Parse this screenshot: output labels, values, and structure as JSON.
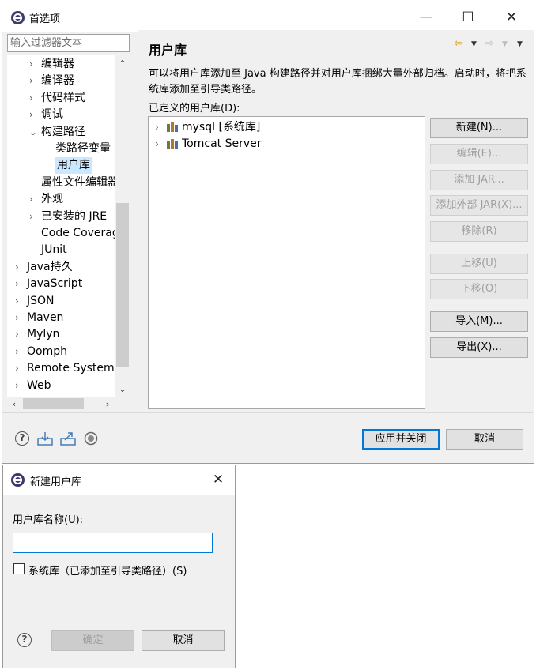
{
  "main_window": {
    "title": "首选项",
    "controls": {
      "minimize": "—",
      "maximize": "☐",
      "close": "✕"
    },
    "filter_placeholder": "输入过滤器文本",
    "tree": [
      {
        "label": "编辑器",
        "arrow": "›"
      },
      {
        "label": "编译器",
        "arrow": "›"
      },
      {
        "label": "代码样式",
        "arrow": "›"
      },
      {
        "label": "调试",
        "arrow": "›"
      },
      {
        "label": "构建路径",
        "arrow": "⌄"
      },
      {
        "label": "类路径变量",
        "arrow": ""
      },
      {
        "label": "用户库",
        "arrow": "",
        "selected": true
      },
      {
        "label": "属性文件编辑器",
        "arrow": ""
      },
      {
        "label": "外观",
        "arrow": "›"
      },
      {
        "label": "已安装的 JRE",
        "arrow": "›"
      },
      {
        "label": "Code Coverage",
        "arrow": ""
      },
      {
        "label": "JUnit",
        "arrow": ""
      },
      {
        "label": "Java持久",
        "arrow": "›"
      },
      {
        "label": "JavaScript",
        "arrow": "›"
      },
      {
        "label": "JSON",
        "arrow": "›"
      },
      {
        "label": "Maven",
        "arrow": "›"
      },
      {
        "label": "Mylyn",
        "arrow": "›"
      },
      {
        "label": "Oomph",
        "arrow": "›"
      },
      {
        "label": "Remote Systems",
        "arrow": "›"
      },
      {
        "label": "Web",
        "arrow": "›"
      }
    ],
    "scroll": {
      "up": "⌃",
      "down": "⌄",
      "left": "‹",
      "right": "›"
    },
    "panel": {
      "title": "用户库",
      "back_arrow": "⇦",
      "forward_arrow": "⇨",
      "dropdown": "▼",
      "description": "可以将用户库添加至 Java 构建路径并对用户库捆绑大量外部归档。启动时，将把系统库添加至引导类路径。",
      "defined_label": "已定义的用户库(D):",
      "libraries": [
        {
          "arrow": "›",
          "label": "mysql [系统库]"
        },
        {
          "arrow": "›",
          "label": "Tomcat Server"
        }
      ],
      "buttons": {
        "new": "新建(N)...",
        "edit": "编辑(E)...",
        "add_jar": "添加 JAR...",
        "add_external_jar": "添加外部 JAR(X)...",
        "remove": "移除(R)",
        "up": "上移(U)",
        "down": "下移(O)",
        "import": "导入(M)...",
        "export": "导出(X)..."
      }
    },
    "footer": {
      "help": "?",
      "apply_close": "应用并关闭",
      "cancel": "取消"
    }
  },
  "dialog": {
    "title": "新建用户库",
    "close": "✕",
    "name_label": "用户库名称(U):",
    "name_value": "",
    "system_lib_label": "系统库（已添加至引导类路径）(S)",
    "help": "?",
    "ok": "确定",
    "cancel": "取消"
  }
}
